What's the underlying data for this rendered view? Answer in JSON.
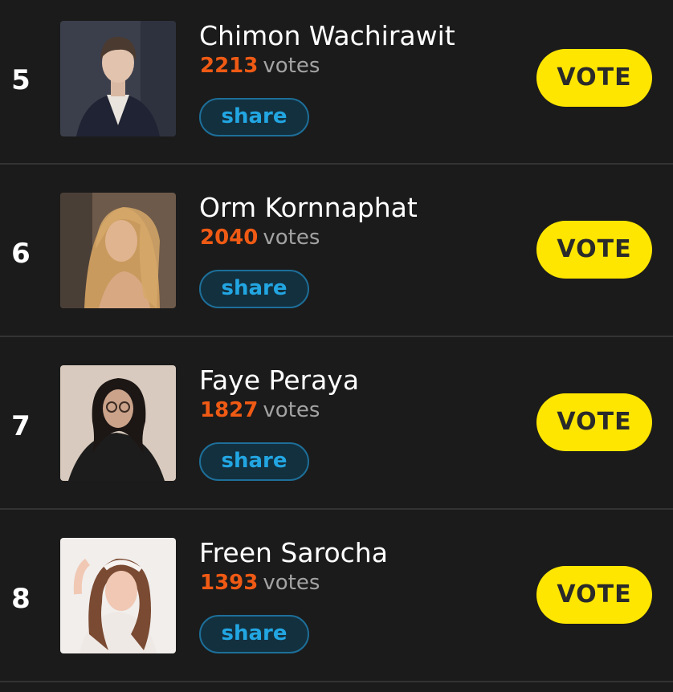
{
  "vote_label": "VOTE",
  "share_label": "share",
  "votes_word": "votes",
  "colors": {
    "vote_count": "#ef5a14",
    "vote_button": "#ffe600",
    "share_text": "#22a6e2",
    "background": "#1b1b1b"
  },
  "entries": [
    {
      "rank": "5",
      "name": "Chimon Wachirawit",
      "votes": "2213",
      "photo": "portrait-photo"
    },
    {
      "rank": "6",
      "name": "Orm Kornnaphat",
      "votes": "2040",
      "photo": "portrait-photo"
    },
    {
      "rank": "7",
      "name": "Faye Peraya",
      "votes": "1827",
      "photo": "portrait-photo"
    },
    {
      "rank": "8",
      "name": "Freen Sarocha",
      "votes": "1393",
      "photo": "portrait-photo"
    }
  ]
}
